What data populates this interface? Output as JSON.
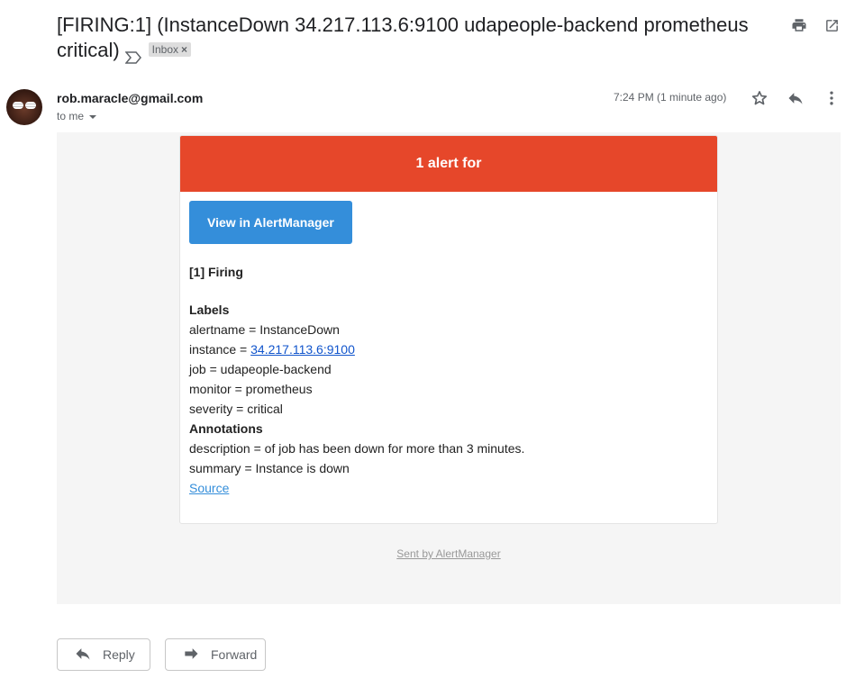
{
  "subject": {
    "text": "[FIRING:1] (InstanceDown 34.217.113.6:9100 udapeople-backend prometheus critical)",
    "label": "Inbox",
    "label_remove": "×"
  },
  "icons": {
    "importance": "importance-marker-icon",
    "print": "print-icon",
    "new_window": "open-in-new-window-icon",
    "star": "star-icon",
    "reply": "reply-icon",
    "more": "more-vert-icon",
    "caret": "chevron-down-icon",
    "forward": "forward-icon"
  },
  "message": {
    "sender": "rob.maracle@gmail.com",
    "recipient": "to me",
    "time": "7:24 PM (1 minute ago)"
  },
  "alert": {
    "header": "1 alert for",
    "header_color": "#e6472a",
    "button": "View in AlertManager",
    "button_color": "#348eda",
    "firing": "[1] Firing",
    "labels_title": "Labels",
    "labels": [
      {
        "key": "alertname",
        "value": "InstanceDown"
      },
      {
        "key": "instance",
        "value": "34.217.113.6:9100"
      },
      {
        "key": "job",
        "value": "udapeople-backend"
      },
      {
        "key": "monitor",
        "value": "prometheus"
      },
      {
        "key": "severity",
        "value": "critical"
      }
    ],
    "annotations_title": "Annotations",
    "annotations": [
      {
        "key": "description",
        "value": "of job has been down for more than 3 minutes."
      },
      {
        "key": "summary",
        "value": "Instance is down"
      }
    ],
    "source_link": "Source",
    "footer": "Sent by AlertManager"
  },
  "actions": {
    "reply": "Reply",
    "forward": "Forward"
  }
}
